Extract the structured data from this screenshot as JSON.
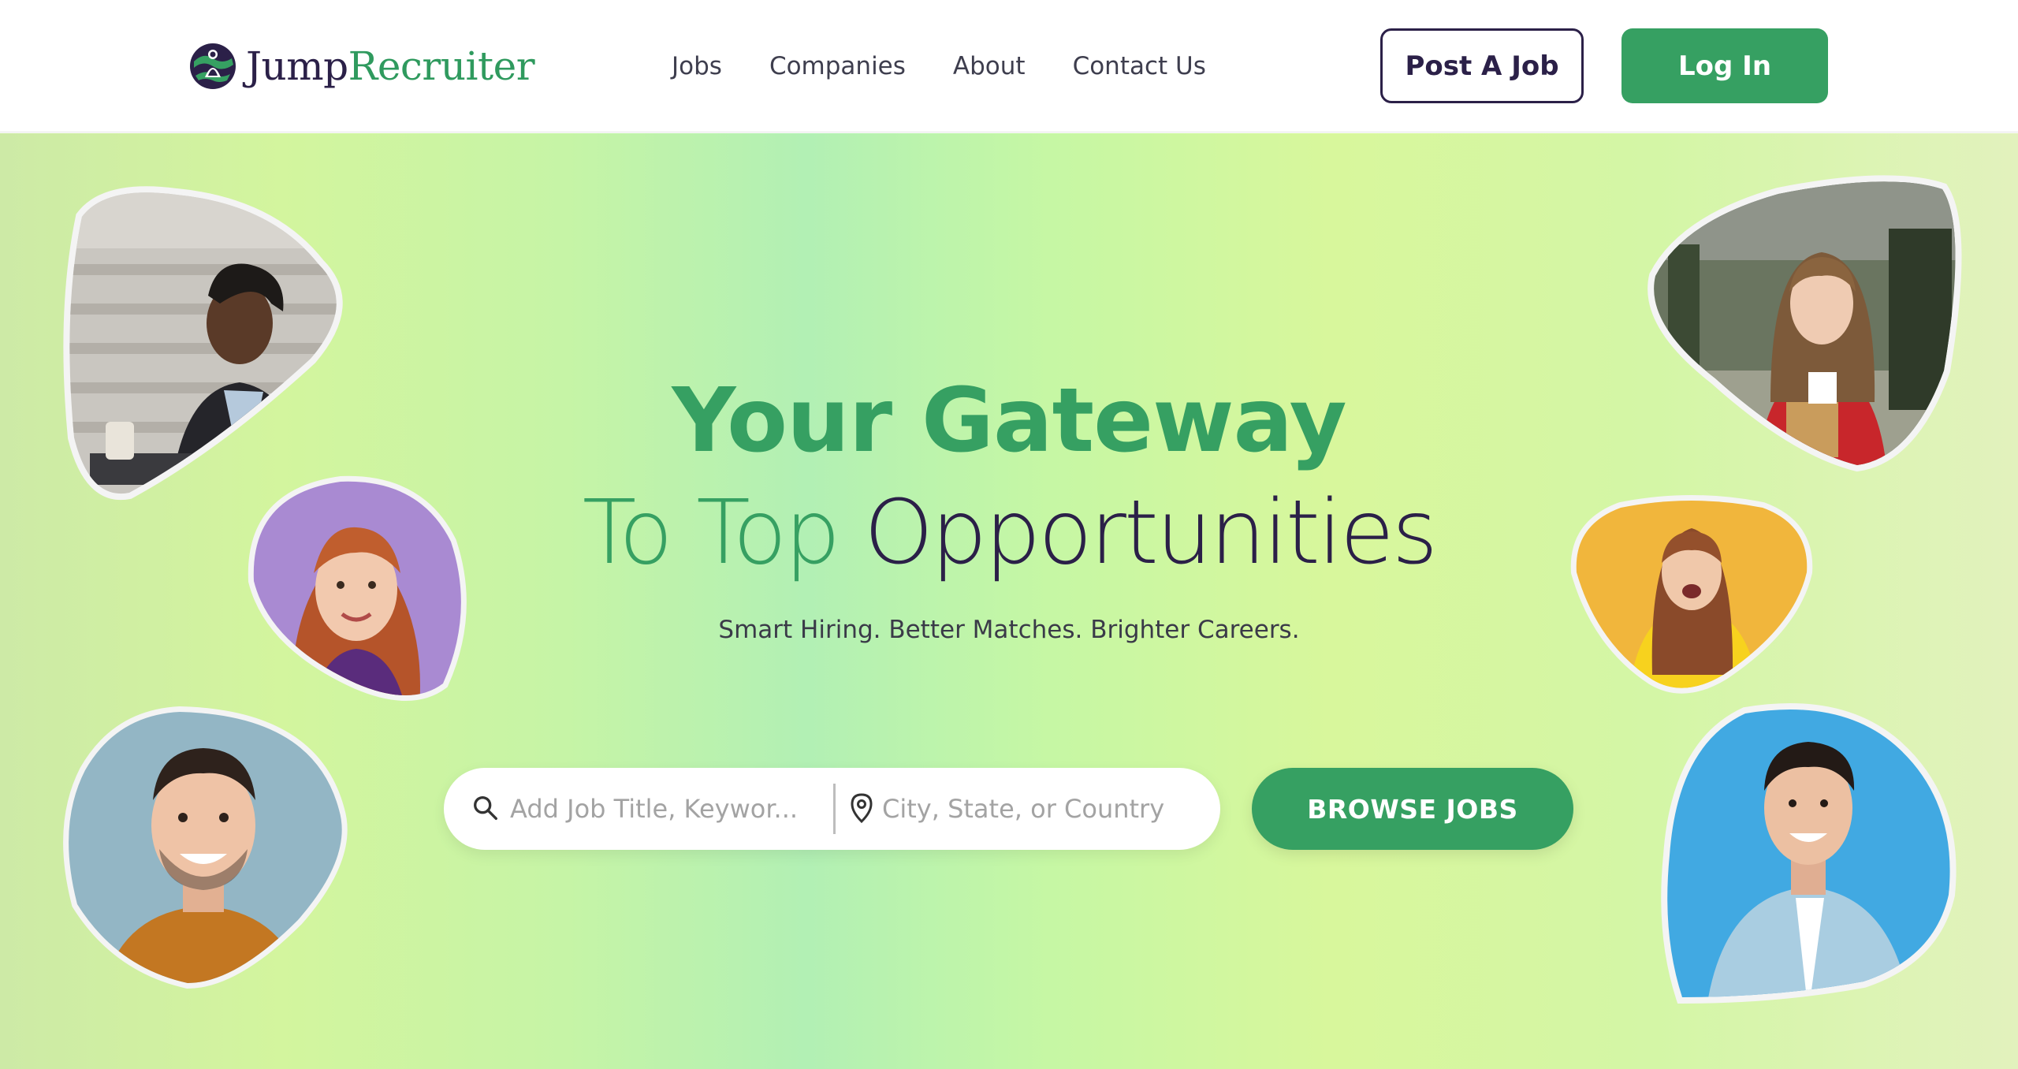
{
  "header": {
    "logo": {
      "text_part1": "Jump",
      "text_part2": "Recruiter",
      "icon": "globe-people-logo-icon"
    },
    "nav": [
      "Jobs",
      "Companies",
      "About",
      "Contact Us"
    ],
    "post_job_label": "Post A Job",
    "login_label": "Log In"
  },
  "hero": {
    "title_line1": "Your Gateway",
    "title_line2_green": "To Top",
    "title_line2_dark": "Opportunities",
    "tagline": "Smart Hiring. Better Matches. Brighter Careers.",
    "search": {
      "keyword_placeholder": "Add Job Title, Keywor...",
      "location_placeholder": "City, State, or Country",
      "keyword_icon": "search-icon",
      "location_icon": "map-pin-icon"
    },
    "browse_label": "BROWSE JOBS"
  },
  "colors": {
    "brand_green": "#36a062",
    "brand_dark": "#2b2048",
    "hero_gradient": [
      "#cdeaa6",
      "#b2f0b4",
      "#d8f79c",
      "#e2f2bd"
    ]
  }
}
